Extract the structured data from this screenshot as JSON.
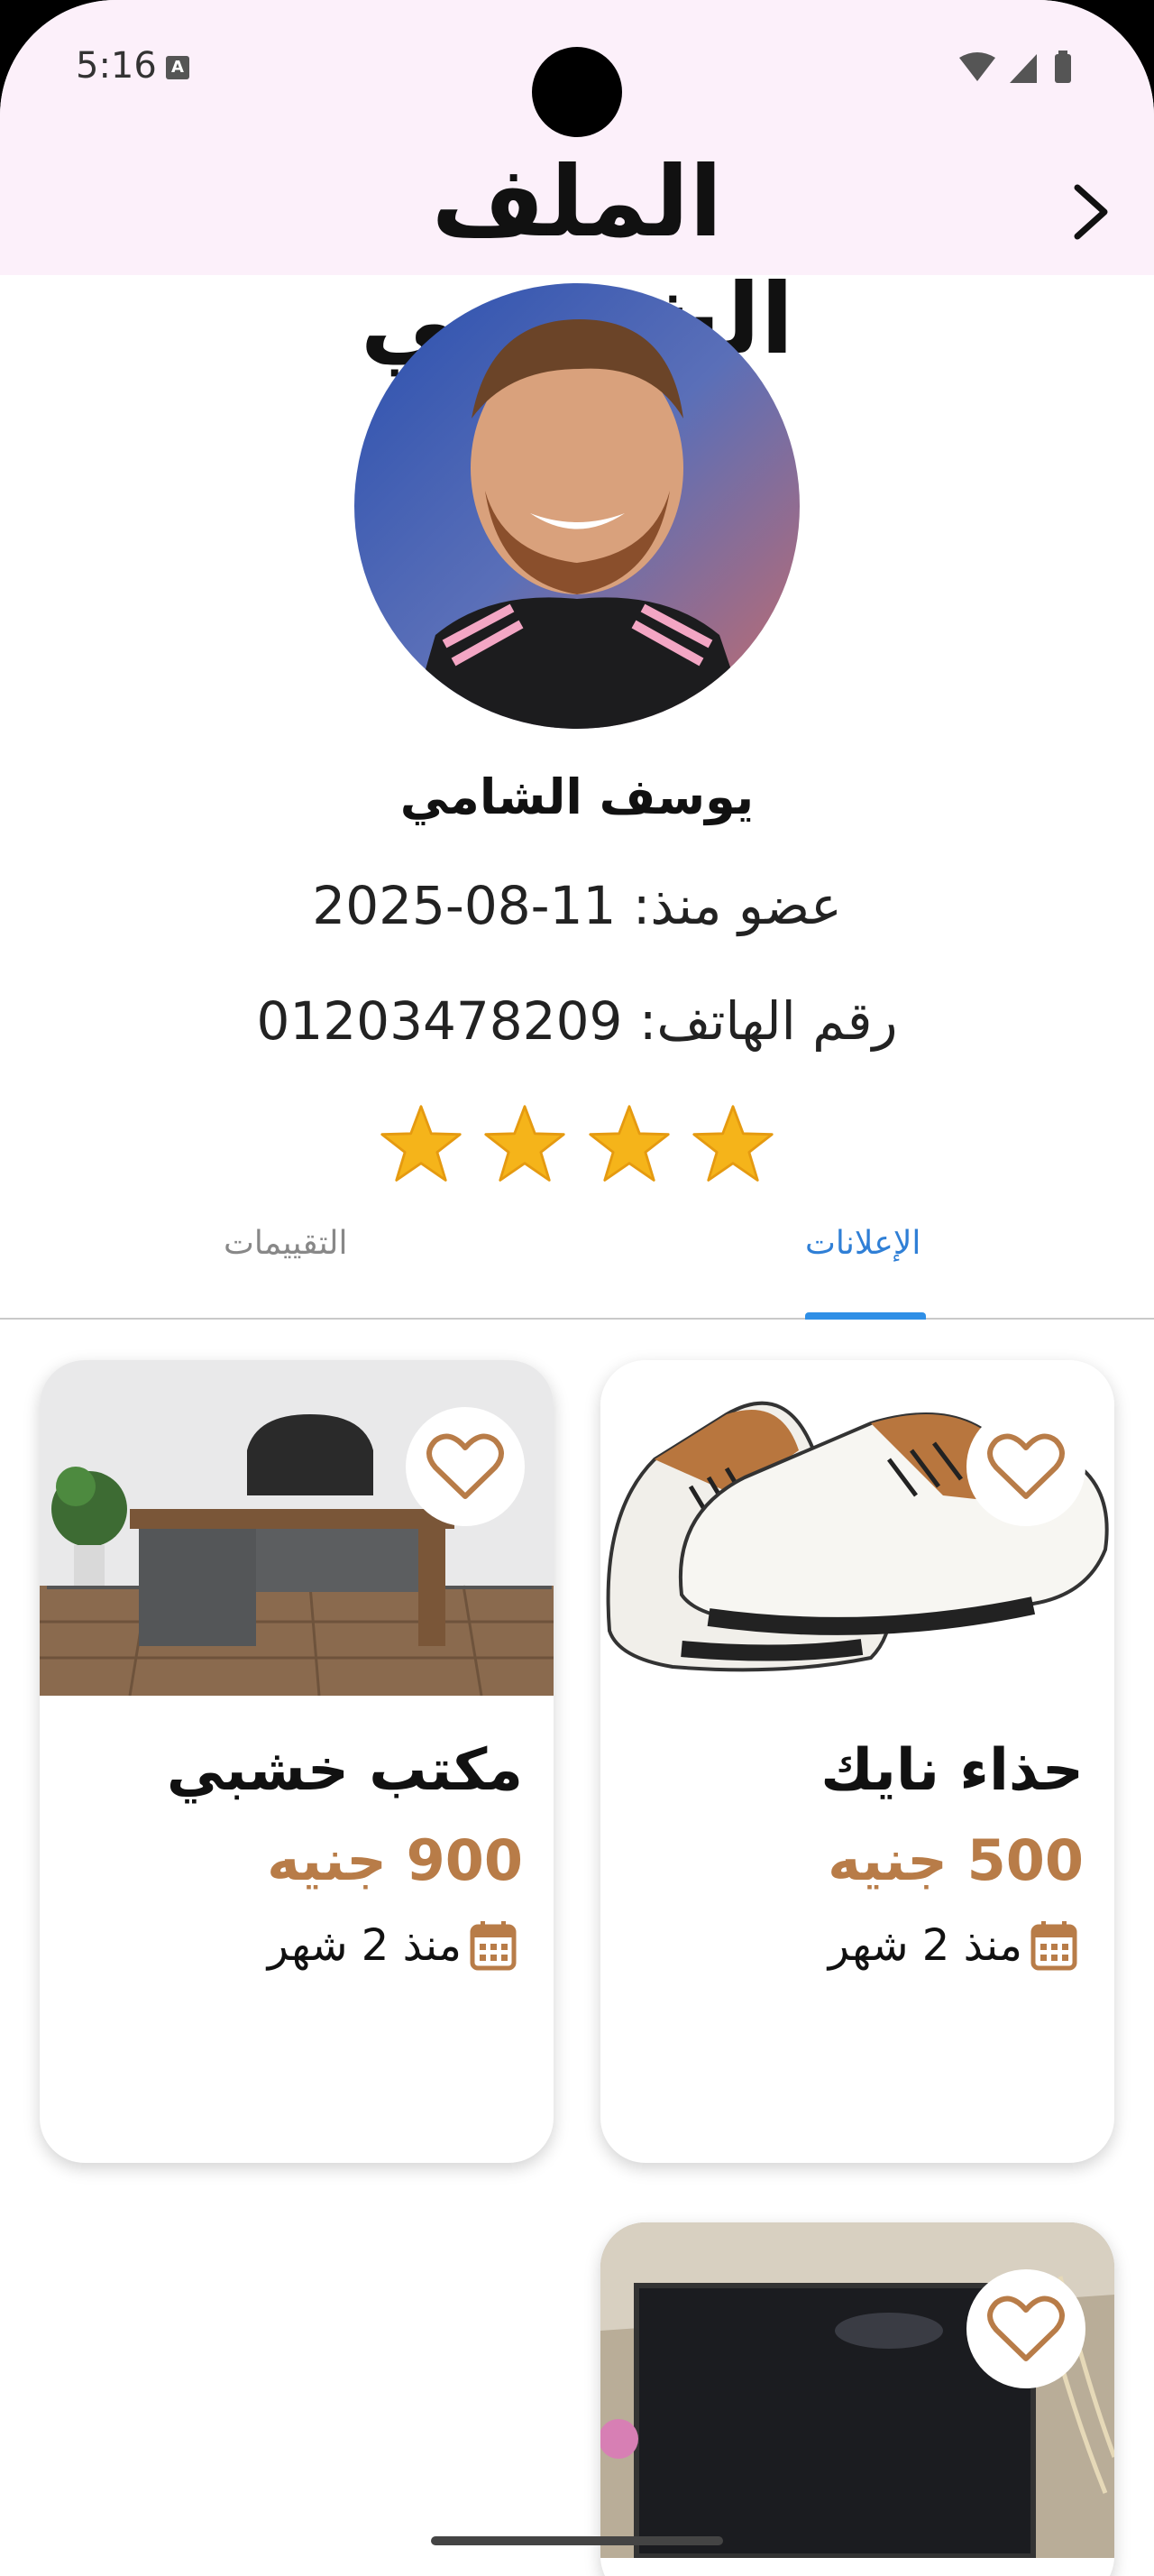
{
  "status_bar": {
    "time": "5:16",
    "notification_badge": "A"
  },
  "header": {
    "title": "الملف الشخصي",
    "back_icon": "chevron-right-icon"
  },
  "profile": {
    "name": "يوسف الشامي",
    "member_since": "عضو منذ: 11-08-2025",
    "phone": "رقم الهاتف: 01203478209",
    "rating_stars": 4,
    "star_color": "#f5b41a"
  },
  "tabs": [
    {
      "label": "الإعلانات",
      "active": true
    },
    {
      "label": "التقييمات",
      "active": false
    }
  ],
  "colors": {
    "accent": "#2f7fd6",
    "price": "#b87c48",
    "header_bg": "#fcf0fa"
  },
  "listings": [
    {
      "title": "حذاء نايك",
      "price": "500 جنيه",
      "date": "منذ 2 شهر",
      "image": "shoes-photo"
    },
    {
      "title": "مكتب خشبي",
      "price": "900 جنيه",
      "date": "منذ 2 شهر",
      "image": "desk-photo"
    },
    {
      "title": "",
      "price": "",
      "date": "",
      "image": "tv-photo"
    }
  ]
}
